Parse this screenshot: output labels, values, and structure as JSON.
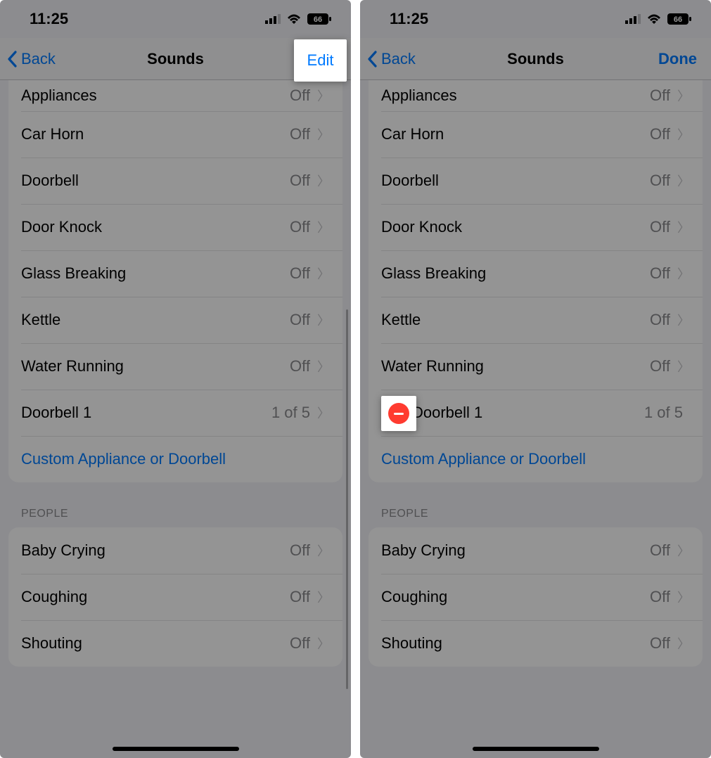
{
  "status": {
    "time": "11:25",
    "battery": "66"
  },
  "nav": {
    "back": "Back",
    "title": "Sounds",
    "edit": "Edit",
    "done": "Done"
  },
  "sounds": [
    {
      "label": "Appliances",
      "value": "Off"
    },
    {
      "label": "Car Horn",
      "value": "Off"
    },
    {
      "label": "Doorbell",
      "value": "Off"
    },
    {
      "label": "Door Knock",
      "value": "Off"
    },
    {
      "label": "Glass Breaking",
      "value": "Off"
    },
    {
      "label": "Kettle",
      "value": "Off"
    },
    {
      "label": "Water Running",
      "value": "Off"
    },
    {
      "label": "Doorbell 1",
      "value": "1 of 5"
    }
  ],
  "custom_link": "Custom Appliance or Doorbell",
  "section_people": "PEOPLE",
  "people": [
    {
      "label": "Baby Crying",
      "value": "Off"
    },
    {
      "label": "Coughing",
      "value": "Off"
    },
    {
      "label": "Shouting",
      "value": "Off"
    }
  ]
}
